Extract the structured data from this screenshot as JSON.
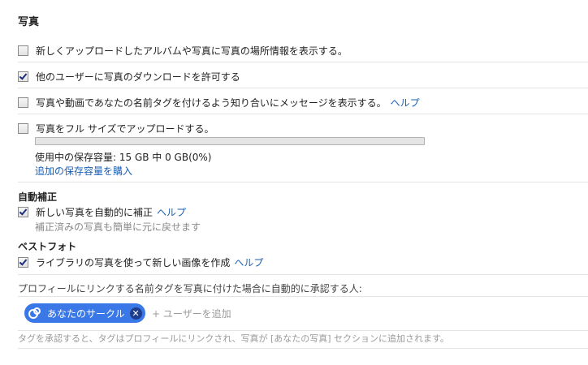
{
  "section_title": "写真",
  "options": {
    "location_info": {
      "label": "新しくアップロードしたアルバムや写真に写真の場所情報を表示する。",
      "checked": false
    },
    "allow_download": {
      "label": "他のユーザーに写真のダウンロードを許可する",
      "checked": true
    },
    "name_tag_message": {
      "label": "写真や動画であなたの名前タグを付けるよう知り合いにメッセージを表示する。",
      "help": "ヘルプ",
      "checked": false
    },
    "full_size_upload": {
      "label": "写真をフル サイズでアップロードする。",
      "checked": false
    }
  },
  "storage": {
    "usage_text": "使用中の保存容量: 15 GB 中 0 GB(0%)",
    "usage_fraction": 0,
    "buy_link": "追加の保存容量を購入"
  },
  "auto_enhance": {
    "title": "自動補正",
    "option_label": "新しい写真を自動的に補正",
    "help": "ヘルプ",
    "checked": true,
    "note": "補正済みの写真も簡単に元に戻せます"
  },
  "best_photo": {
    "title": "ベストフォト",
    "option_label": "ライブラリの写真を使って新しい画像を作成",
    "help": "ヘルプ",
    "checked": true
  },
  "tag_approval": {
    "label": "プロフィールにリンクする名前タグを写真に付けた場合に自動的に承認する人:",
    "chip_label": "あなたのサークル",
    "chip_icon": "circles-icon",
    "add_user": "+ ユーザーを追加",
    "footer": "タグを承認すると、タグはプロフィールにリンクされ、写真が [あなたの写真] セクションに追加されます。"
  },
  "colors": {
    "link": "#1a5fb4",
    "chip": "#3b78e7",
    "progress": "#4d90fe"
  }
}
